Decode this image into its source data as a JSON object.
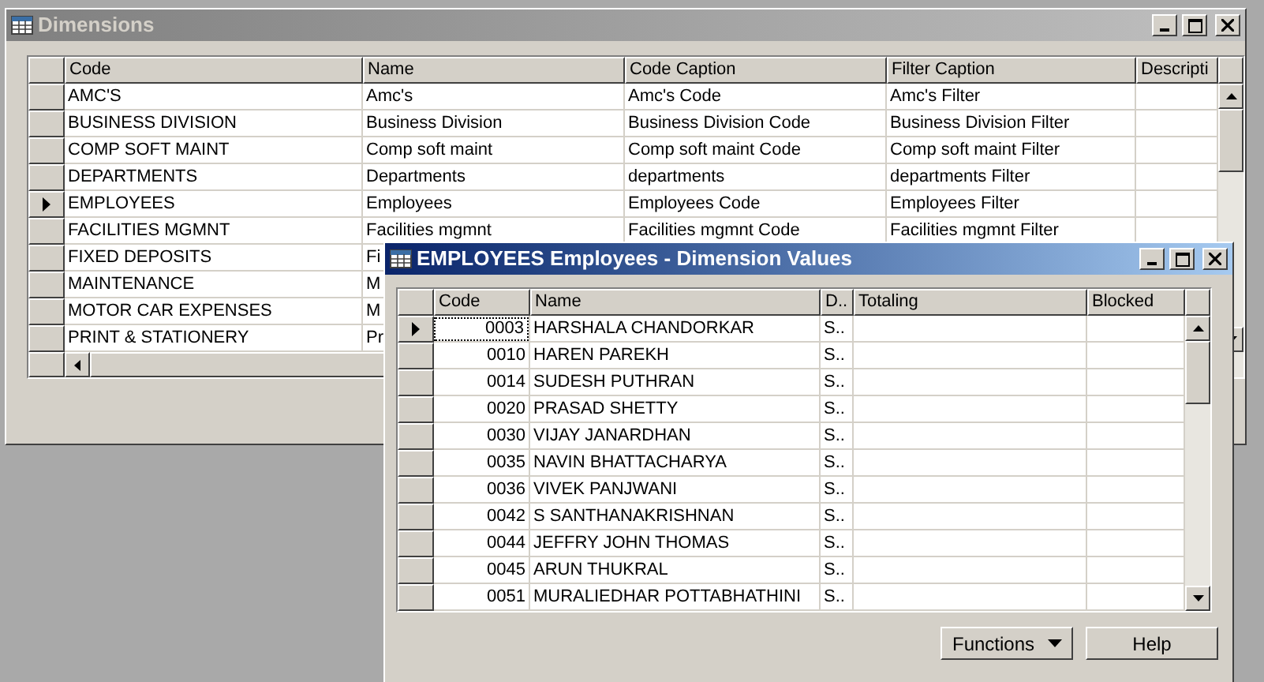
{
  "dimensions_window": {
    "title": "Dimensions",
    "active": false,
    "columns": [
      "Code",
      "Name",
      "Code Caption",
      "Filter Caption",
      "Descripti"
    ],
    "rows": [
      {
        "selected": false,
        "cells": [
          "AMC'S",
          "Amc's",
          "Amc's Code",
          "Amc's Filter"
        ]
      },
      {
        "selected": false,
        "cells": [
          "BUSINESS DIVISION",
          "Business Division",
          "Business Division Code",
          "Business Division Filter"
        ]
      },
      {
        "selected": false,
        "cells": [
          "COMP SOFT MAINT",
          "Comp soft maint",
          "Comp soft maint Code",
          "Comp soft maint Filter"
        ]
      },
      {
        "selected": false,
        "cells": [
          "DEPARTMENTS",
          "Departments",
          "departments",
          "departments Filter"
        ]
      },
      {
        "selected": true,
        "cells": [
          "EMPLOYEES",
          "Employees",
          "Employees Code",
          "Employees Filter"
        ]
      },
      {
        "selected": false,
        "cells": [
          "FACILITIES MGMNT",
          "Facilities mgmnt",
          "Facilities mgmnt Code",
          "Facilities mgmnt Filter"
        ]
      },
      {
        "selected": false,
        "cells": [
          "FIXED DEPOSITS",
          "Fi"
        ]
      },
      {
        "selected": false,
        "cells": [
          "MAINTENANCE",
          "M"
        ]
      },
      {
        "selected": false,
        "cells": [
          "MOTOR CAR EXPENSES",
          "M"
        ]
      },
      {
        "selected": false,
        "cells": [
          "PRINT & STATIONERY",
          "Pr"
        ]
      }
    ]
  },
  "values_window": {
    "title": "EMPLOYEES Employees - Dimension Values",
    "active": true,
    "columns": [
      "Code",
      "Name",
      "D..",
      "Totaling",
      "Blocked"
    ],
    "rows": [
      {
        "selected": true,
        "cells": [
          "0003",
          "HARSHALA CHANDORKAR",
          "S.."
        ]
      },
      {
        "selected": false,
        "cells": [
          "0010",
          "HAREN PAREKH",
          "S.."
        ]
      },
      {
        "selected": false,
        "cells": [
          "0014",
          "SUDESH PUTHRAN",
          "S.."
        ]
      },
      {
        "selected": false,
        "cells": [
          "0020",
          "PRASAD SHETTY",
          "S.."
        ]
      },
      {
        "selected": false,
        "cells": [
          "0030",
          "VIJAY JANARDHAN",
          "S.."
        ]
      },
      {
        "selected": false,
        "cells": [
          "0035",
          "NAVIN BHATTACHARYA",
          "S.."
        ]
      },
      {
        "selected": false,
        "cells": [
          "0036",
          "VIVEK PANJWANI",
          "S.."
        ]
      },
      {
        "selected": false,
        "cells": [
          "0042",
          "S SANTHANAKRISHNAN",
          "S.."
        ]
      },
      {
        "selected": false,
        "cells": [
          "0044",
          "JEFFRY JOHN THOMAS",
          "S.."
        ]
      },
      {
        "selected": false,
        "cells": [
          "0045",
          "ARUN THUKRAL",
          "S.."
        ]
      },
      {
        "selected": false,
        "cells": [
          "0051",
          "MURALIEDHAR POTTABHATHINI",
          "S.."
        ]
      }
    ],
    "buttons": [
      {
        "label": "Functions",
        "kind": "menu"
      },
      {
        "label": "Help",
        "kind": "plain"
      }
    ]
  }
}
